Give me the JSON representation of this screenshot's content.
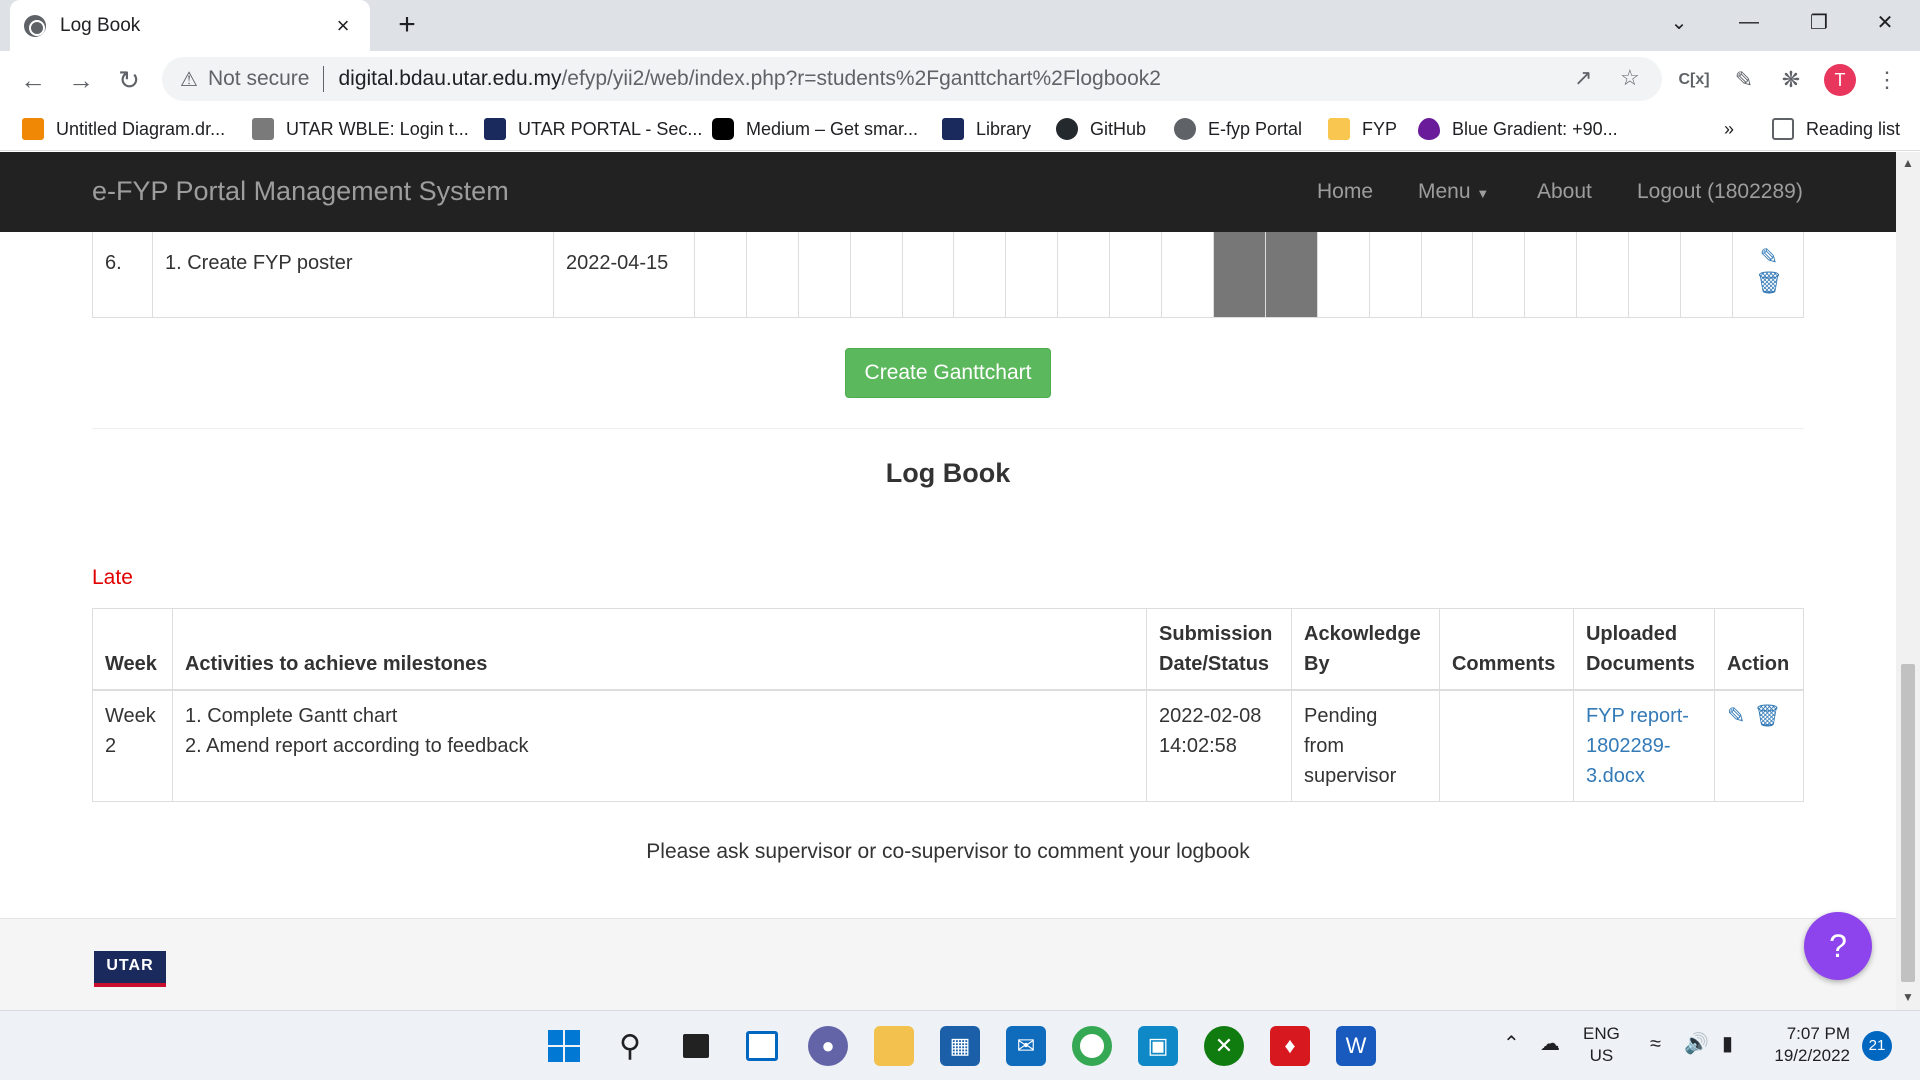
{
  "browser": {
    "tab_title": "Log Book",
    "tab_close": "×",
    "new_tab": "+",
    "security_label": "Not secure",
    "url_host": "digital.bdau.utar.edu.my",
    "url_path": "/efyp/yii2/web/index.php?r=students%2Fganttchart%2Flogbook2",
    "avatar_letter": "T",
    "bookmarks": [
      {
        "label": "Untitled Diagram.dr...",
        "color": "#f08705"
      },
      {
        "label": "UTAR WBLE: Login t...",
        "color": "#7a7a7a"
      },
      {
        "label": "UTAR PORTAL - Sec...",
        "color": "#1b2a5c"
      },
      {
        "label": "Medium – Get smar...",
        "color": "#000000"
      },
      {
        "label": "Library",
        "color": "#1b2a5c"
      },
      {
        "label": "GitHub",
        "color": "#24292e"
      },
      {
        "label": "E-fyp Portal",
        "color": "#5f6368"
      },
      {
        "label": "FYP",
        "color": "#f9c74f"
      },
      {
        "label": "Blue Gradient: +90...",
        "color": "#6a1b9a"
      }
    ],
    "bookmarks_more": "»",
    "reading_list": "Reading list"
  },
  "navbar": {
    "brand": "e-FYP Portal Management System",
    "links": [
      "Home",
      "Menu",
      "About",
      "Logout (1802289)"
    ]
  },
  "gantt": {
    "row_no": "6.",
    "task": "1. Create FYP poster",
    "date": "2022-04-15",
    "week_cells": 20,
    "filled_weeks": [
      10,
      11
    ]
  },
  "create_button": "Create Ganttchart",
  "logbook": {
    "title": "Log Book",
    "status_label": "Late",
    "headers": {
      "week": "Week",
      "activities": "Activities to achieve milestones",
      "submission_1": "Submission",
      "submission_2": "Date/Status",
      "ack_1": "Ackowledge",
      "ack_2": "By",
      "comments": "Comments",
      "uploaded_1": "Uploaded",
      "uploaded_2": "Documents",
      "action": "Action"
    },
    "rows": [
      {
        "week_1": "Week",
        "week_2": "2",
        "activity_1": "1. Complete Gantt chart",
        "activity_2": "2. Amend report according to feedback",
        "date_1": "2022-02-08",
        "date_2": "14:02:58",
        "ack_1": "Pending",
        "ack_2": "from",
        "ack_3": "supervisor",
        "comments": "",
        "doc_1": "FYP report-",
        "doc_2": "1802289-",
        "doc_3": "3.docx"
      }
    ],
    "note": "Please ask supervisor or co-supervisor to comment your logbook"
  },
  "footer": {
    "logo_text": "UTAR"
  },
  "help_button": "?",
  "taskbar": {
    "lang_1": "ENG",
    "lang_2": "US",
    "time": "7:07 PM",
    "date": "19/2/2022",
    "notifications": "21"
  },
  "colors": {
    "navbar_bg": "#222222",
    "create_button": "#5cb85c",
    "late_text": "#e00000",
    "link": "#337ab7",
    "help_button": "#8e44ec"
  }
}
